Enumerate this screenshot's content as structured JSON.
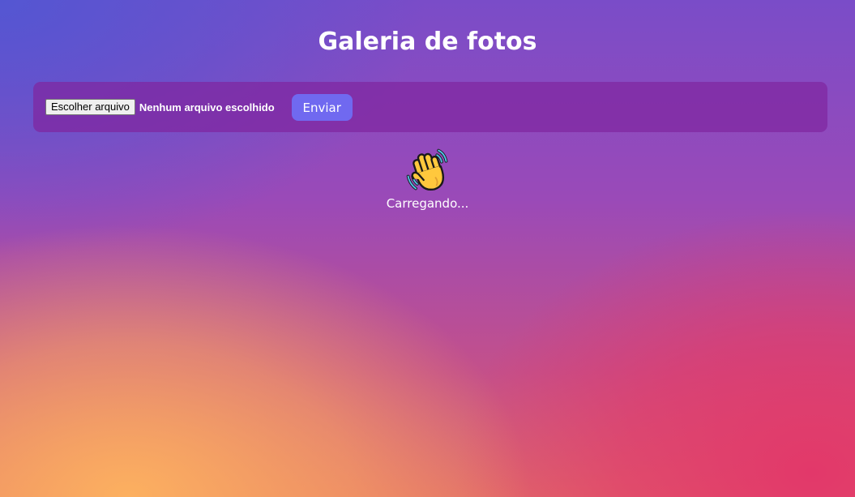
{
  "header": {
    "title": "Galeria de fotos"
  },
  "upload": {
    "file_button_label": "Escolher arquivo",
    "file_status": "Nenhum arquivo escolhido",
    "submit_label": "Enviar"
  },
  "loading": {
    "icon": "waving-hand-icon",
    "text": "Carregando..."
  },
  "colors": {
    "submit_button": "#7069f0",
    "panel": "#8026a0",
    "text": "#ffffff"
  }
}
